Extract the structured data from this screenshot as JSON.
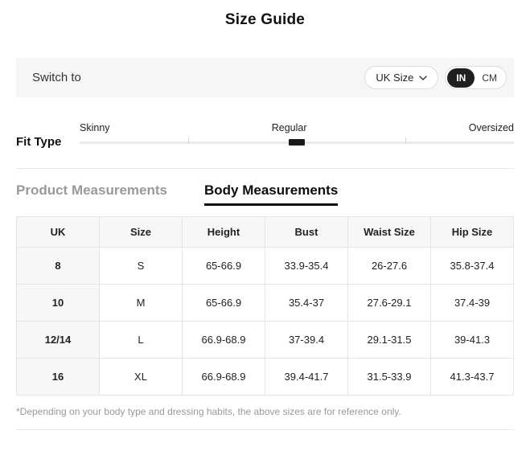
{
  "page": {
    "title": "Size Guide"
  },
  "switch_bar": {
    "label": "Switch to",
    "size_dropdown": {
      "value": "UK Size",
      "chevron_icon": "chevron-down"
    },
    "unit_toggle": {
      "options": [
        "IN",
        "CM"
      ],
      "selected": "IN"
    }
  },
  "fit_type": {
    "label": "Fit Type",
    "options": [
      "Skinny",
      "Regular",
      "Oversized"
    ],
    "selected": "Regular"
  },
  "tabs": [
    {
      "label": "Product Measurements",
      "active": false
    },
    {
      "label": "Body Measurements",
      "active": true
    }
  ],
  "size_table": {
    "headers": [
      "UK",
      "Size",
      "Height",
      "Bust",
      "Waist Size",
      "Hip Size"
    ],
    "rows": [
      [
        "8",
        "S",
        "65-66.9",
        "33.9-35.4",
        "26-27.6",
        "35.8-37.4"
      ],
      [
        "10",
        "M",
        "65-66.9",
        "35.4-37",
        "27.6-29.1",
        "37.4-39"
      ],
      [
        "12/14",
        "L",
        "66.9-68.9",
        "37-39.4",
        "29.1-31.5",
        "39-41.3"
      ],
      [
        "16",
        "XL",
        "66.9-68.9",
        "39.4-41.7",
        "31.5-33.9",
        "41.3-43.7"
      ]
    ]
  },
  "footnote": "*Depending on your body type and dressing habits, the above sizes are for reference only.",
  "colors": {
    "accent_dark": "#1f1f1f",
    "muted_text": "#999999",
    "bar_background": "#f6f6f6",
    "table_border": "#e5e5e5",
    "header_background": "#f7f7f7"
  }
}
